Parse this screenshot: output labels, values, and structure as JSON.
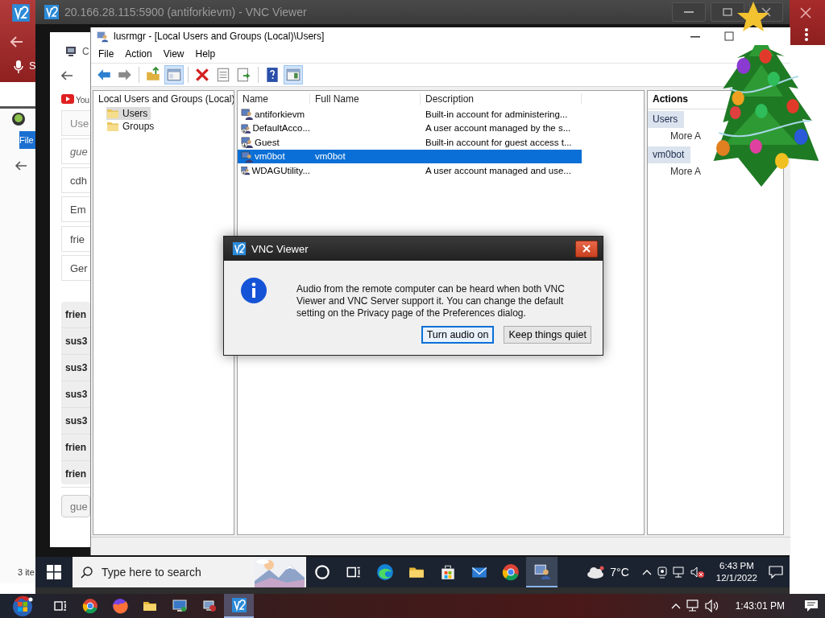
{
  "host": {
    "corner_label": "S",
    "side_window_menu": "File",
    "side_window_status": "3 ite"
  },
  "vnc_window": {
    "title": "20.166.28.115:5900 (antiforkievm) - VNC Viewer"
  },
  "remote_browser": {
    "tab_label": "C",
    "bookmark": "You",
    "items": [
      {
        "text": "Use",
        "kind": "header"
      },
      {
        "text": "gue",
        "kind": "italic"
      },
      {
        "text": "cdh",
        "kind": "plain"
      },
      {
        "text": "Em",
        "kind": "plain"
      },
      {
        "text": "frie",
        "kind": "plain"
      },
      {
        "text": "Ger",
        "kind": "plain"
      }
    ],
    "bold_items": [
      "frien",
      "sus3",
      "sus3",
      "sus3",
      "sus3",
      "frien",
      "frien"
    ],
    "placeholder": "gue"
  },
  "lusrmgr": {
    "title": "lusrmgr - [Local Users and Groups (Local)\\Users]",
    "menu": [
      "File",
      "Action",
      "View",
      "Help"
    ],
    "toolbar_groups": [
      [
        {
          "kind": "back",
          "pressed": false
        },
        {
          "kind": "forward",
          "pressed": false
        }
      ],
      [
        {
          "kind": "up",
          "pressed": false
        },
        {
          "kind": "tree",
          "pressed": true
        }
      ],
      [
        {
          "kind": "delete",
          "pressed": false
        },
        {
          "kind": "properties",
          "pressed": false
        },
        {
          "kind": "export",
          "pressed": false
        }
      ],
      [
        {
          "kind": "help",
          "pressed": false
        },
        {
          "kind": "action_pane",
          "pressed": true
        }
      ]
    ],
    "tree": {
      "label": "Local Users and Groups (Local)",
      "children": [
        {
          "label": "Users",
          "selected": true
        },
        {
          "label": "Groups",
          "selected": false
        }
      ]
    },
    "columns": [
      "Name",
      "Full Name",
      "Description"
    ],
    "rows": [
      {
        "name": "antiforkievm",
        "description": "Built-in account for administering...",
        "disabled": false,
        "selected": false
      },
      {
        "name": "DefaultAcco...",
        "description": "A user account managed by the s...",
        "disabled": true,
        "selected": false
      },
      {
        "name": "Guest",
        "description": "Built-in account for guest access t...",
        "disabled": true,
        "selected": false
      },
      {
        "name": "vm0bot",
        "full_name": "vm0bot",
        "disabled": false,
        "selected": true
      },
      {
        "name": "WDAGUtility...",
        "description": "A user account managed and use...",
        "disabled": true,
        "selected": false
      }
    ],
    "actions": {
      "title": "Actions",
      "sections": [
        {
          "label": "Users",
          "items": [
            "More A"
          ]
        },
        {
          "label": "vm0bot",
          "items": [
            "More A"
          ]
        }
      ]
    }
  },
  "dialog": {
    "title": "VNC Viewer",
    "message": "Audio from the remote computer can be heard when both VNC Viewer and VNC Server support it. You can change the default setting on the Privacy page of the Preferences dialog.",
    "buttons": [
      {
        "label": "Turn audio on",
        "focused": true
      },
      {
        "label": "Keep things quiet",
        "focused": false
      }
    ]
  },
  "remote_taskbar": {
    "search_placeholder": "Type here to search",
    "apps": [
      {
        "kind": "cortana",
        "active": false
      },
      {
        "kind": "task_view",
        "active": false
      },
      {
        "kind": "edge",
        "active": false
      },
      {
        "kind": "explorer",
        "active": false
      },
      {
        "kind": "store",
        "active": false
      },
      {
        "kind": "mail",
        "active": false
      },
      {
        "kind": "chrome",
        "active": false
      },
      {
        "kind": "users_console",
        "active": true
      }
    ],
    "temperature": "7°C",
    "time": "6:43 PM",
    "date": "12/1/2022"
  },
  "host_taskbar": {
    "apps": [
      {
        "kind": "task_view",
        "active": false
      },
      {
        "kind": "chrome",
        "active": false
      },
      {
        "kind": "firefox",
        "active": false
      },
      {
        "kind": "explorer",
        "active": false
      },
      {
        "kind": "remote",
        "active": false
      },
      {
        "kind": "network_tool",
        "active": false
      },
      {
        "kind": "vnc",
        "active": true
      }
    ],
    "time": "1:43:01 PM"
  }
}
